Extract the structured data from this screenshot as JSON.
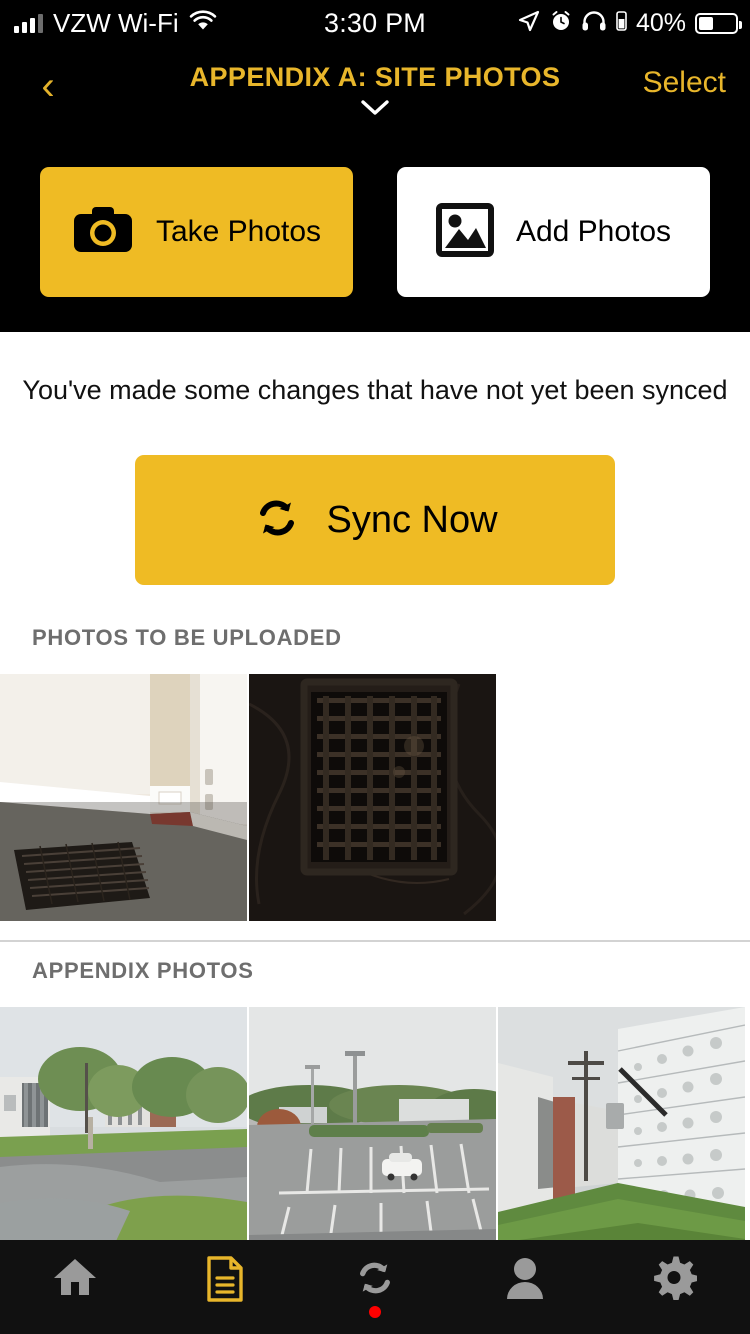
{
  "status_bar": {
    "carrier": "VZW Wi-Fi",
    "time": "3:30 PM",
    "battery_percent": "40%",
    "icons": [
      "signal-bars-icon",
      "wifi-icon",
      "location-arrow-icon",
      "alarm-clock-icon",
      "headphones-icon",
      "battery-icon"
    ]
  },
  "nav": {
    "back_label": "‹",
    "title": "APPENDIX A: SITE PHOTOS",
    "caret": "⌄",
    "select_label": "Select",
    "title_color": "#E8B62B",
    "background": "#000000"
  },
  "actions": {
    "take_photos_label": "Take Photos",
    "add_photos_label": "Add Photos",
    "primary_color": "#EFBB24",
    "secondary_color": "#FFFFFF"
  },
  "sync": {
    "message": "You've made some changes that have not yet been synced",
    "button_label": "Sync Now",
    "button_color": "#EFBB24"
  },
  "sections": [
    {
      "heading": "PHOTOS TO BE UPLOADED",
      "photos": [
        {
          "alt": "floor vent on gray carpet beside white door trim"
        },
        {
          "alt": "dark cast iron floor grate on dark surface"
        }
      ]
    },
    {
      "heading": "APPENDIX PHOTOS",
      "photos": [
        {
          "alt": "wet parking lot with building and green trees"
        },
        {
          "alt": "parking lot with white car and light poles"
        },
        {
          "alt": "grass strip beside white concrete block wall"
        }
      ]
    }
  ],
  "tabbar": {
    "items": [
      {
        "icon": "home-icon",
        "active": false,
        "badge": false
      },
      {
        "icon": "document-icon",
        "active": true,
        "badge": false
      },
      {
        "icon": "sync-icon",
        "active": false,
        "badge": true
      },
      {
        "icon": "person-icon",
        "active": false,
        "badge": false
      },
      {
        "icon": "gear-icon",
        "active": false,
        "badge": false
      }
    ],
    "active_color": "#E8B62B",
    "inactive_color": "#9A9A9A",
    "badge_color": "#FF0000",
    "background": "#111111"
  }
}
